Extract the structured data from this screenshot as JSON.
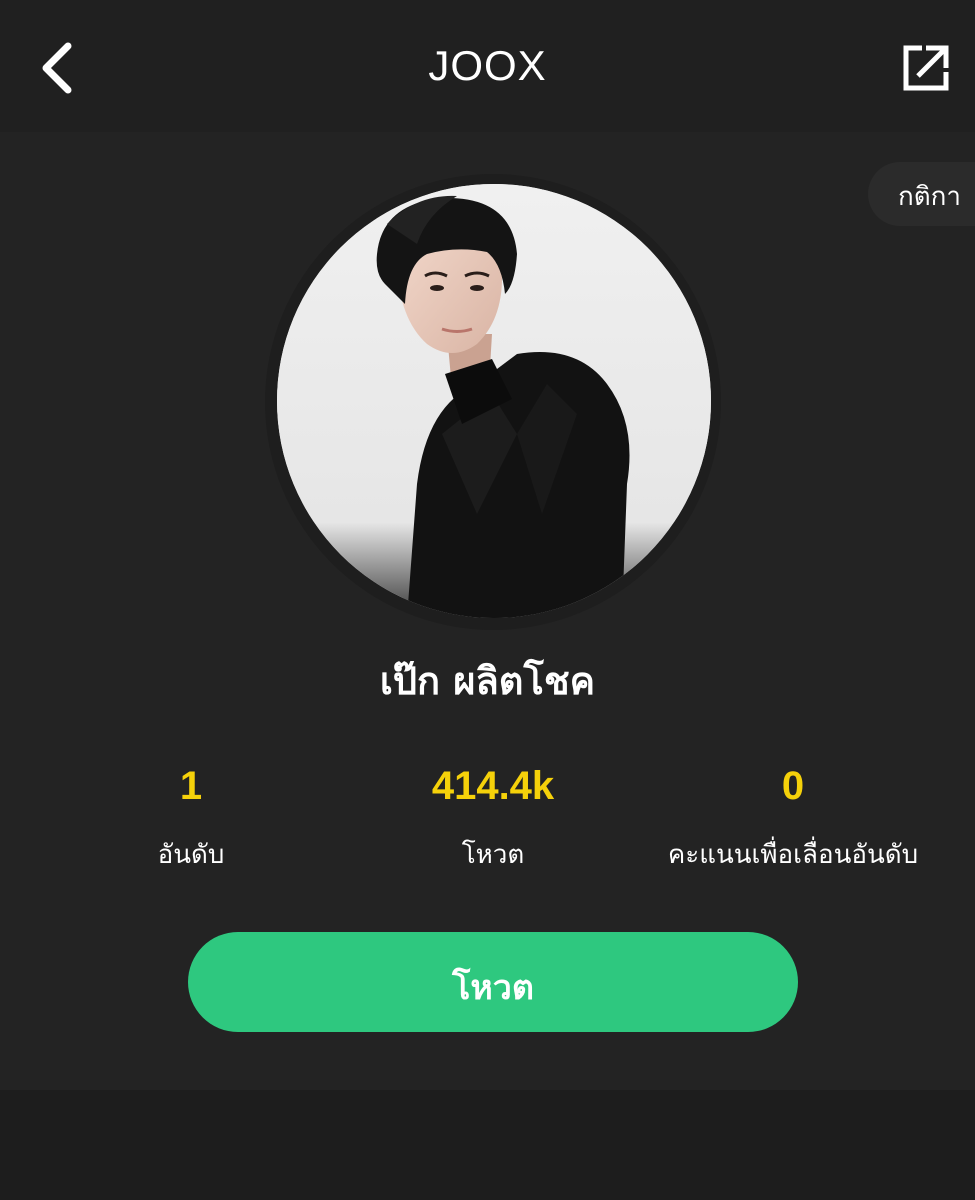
{
  "header": {
    "back_icon": "chevron-left-icon",
    "title": "JOOX",
    "share_icon": "external-share-icon"
  },
  "rules": {
    "label": "กติกา"
  },
  "artist": {
    "photo": "artist-portrait",
    "name": "เป๊ก ผลิตโชค"
  },
  "stats": [
    {
      "value": "1",
      "label": "อันดับ"
    },
    {
      "value": "414.4k",
      "label": "โหวต"
    },
    {
      "value": "0",
      "label": "คะแนนเพื่อเลื่อนอันดับ"
    }
  ],
  "vote_button": {
    "label": "โหวต"
  },
  "colors": {
    "background": "#232323",
    "accent_yellow": "#f5d10a",
    "vote_green": "#2ec87f"
  }
}
